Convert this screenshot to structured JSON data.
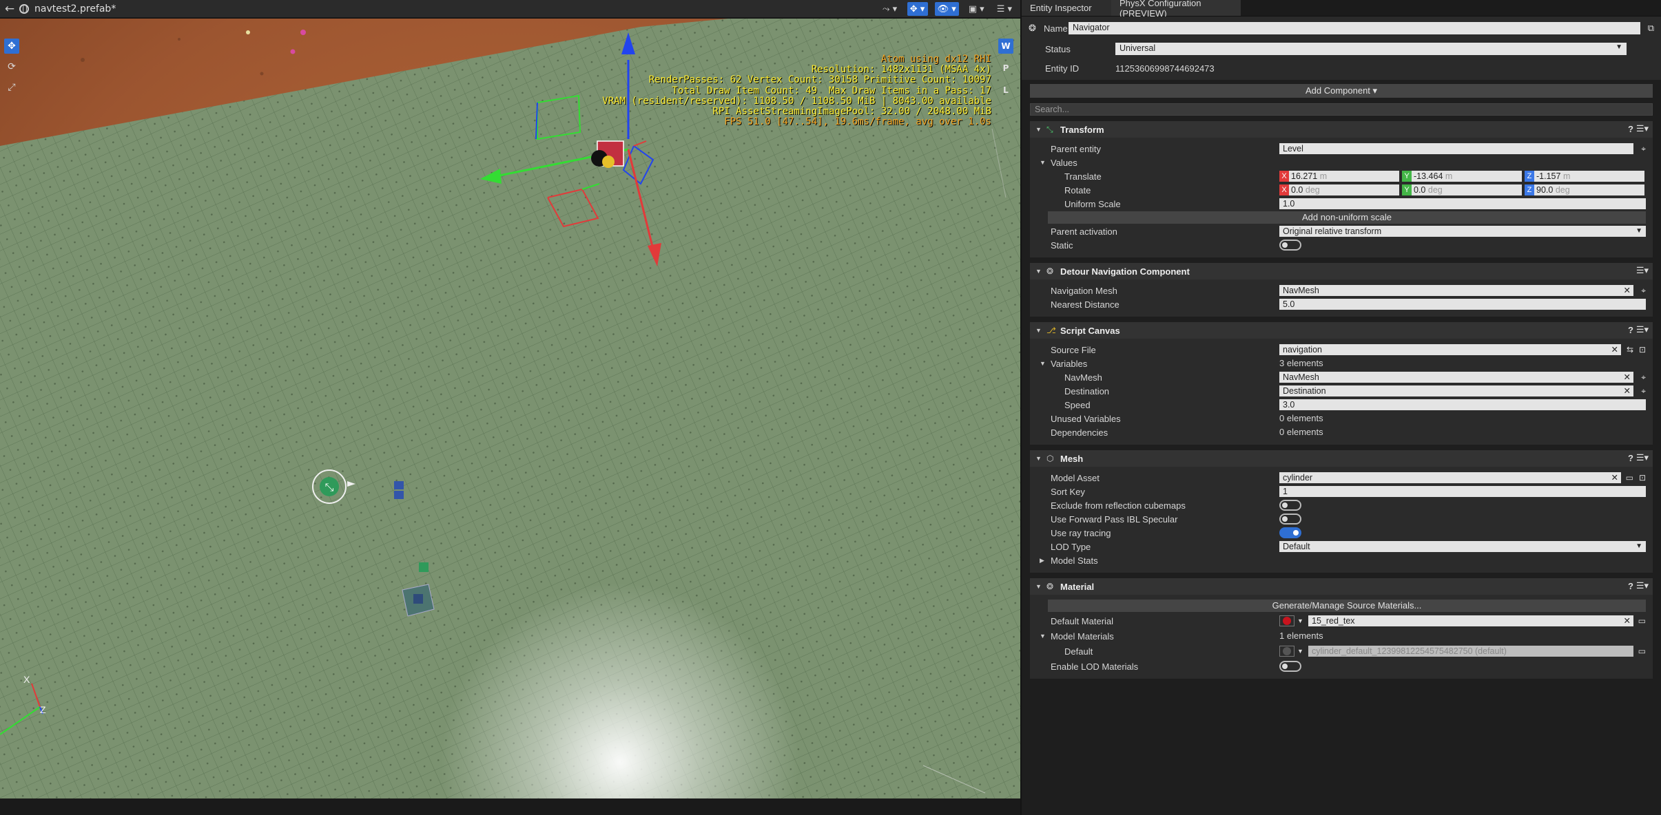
{
  "viewport": {
    "back_icon": "back-arrow-icon",
    "title": "navtest2.prefab*",
    "toolbar_tools": [
      {
        "name": "camera-speed-tool",
        "glyph": "⤳ ▾",
        "active": false
      },
      {
        "name": "gizmo-mode-tool",
        "glyph": "✥ ▾",
        "active": true
      },
      {
        "name": "visibility-tool",
        "glyph": "👁 ▾",
        "active": true
      },
      {
        "name": "layout-tool",
        "glyph": "▣ ▾",
        "active": false
      },
      {
        "name": "options-tool",
        "glyph": "☰ ▾",
        "active": false
      }
    ],
    "left_tools": [
      {
        "name": "move-tool",
        "glyph": "✥",
        "active": true
      },
      {
        "name": "rotate-tool",
        "glyph": "⟳",
        "active": false
      },
      {
        "name": "scale-tool",
        "glyph": "⤢",
        "active": false
      }
    ],
    "right_tools": [
      {
        "name": "world-space-toggle",
        "glyph": "W",
        "active": true
      },
      {
        "name": "parent-space-toggle",
        "glyph": "P",
        "active": false
      },
      {
        "name": "local-space-toggle",
        "glyph": "L",
        "active": false
      }
    ],
    "debug_lines": [
      "Atom using dx12 RHI",
      "Resolution: 1482x1131 (MSAA 4x)",
      "RenderPasses: 62 Vertex Count: 30158 Primitive Count: 10097",
      "Total Draw Item Count: 49  Max Draw Items in a Pass: 17",
      "VRAM (resident/reserved): 1108.50 / 1108.50 MiB | 8043.00 available",
      "RPI AssetStreamingImagePool: 32.00 / 2048.00 MiB",
      "FPS 51.0 [47..54], 19.6ms/frame, avg over 1.0s"
    ],
    "axis_labels": {
      "x": "X",
      "z": "Z"
    },
    "colors": {
      "accent": "#2f6fd3",
      "gizmo_x": "#e23a3a",
      "gizmo_y": "#33dd33",
      "gizmo_z": "#2244ee",
      "debug_text": "#ffee33"
    }
  },
  "inspector": {
    "tabs": [
      {
        "label": "Entity Inspector",
        "active": true
      },
      {
        "label": "PhysX Configuration (PREVIEW)",
        "active": false
      }
    ],
    "name_label": "Name",
    "name_value": "Navigator",
    "status_label": "Status",
    "status_value": "Universal",
    "entity_id_label": "Entity ID",
    "entity_id_value": "11253606998744692473",
    "add_component": "Add Component ▾",
    "search_placeholder": "Search...",
    "transform": {
      "title": "Transform",
      "parent_entity_label": "Parent entity",
      "parent_entity_value": "Level",
      "values_label": "Values",
      "translate_label": "Translate",
      "translate": {
        "x": "16.271",
        "y": "-13.464",
        "z": "-1.157",
        "unit": "m"
      },
      "rotate_label": "Rotate",
      "rotate": {
        "x": "0.0",
        "y": "0.0",
        "z": "90.0",
        "unit": "deg"
      },
      "uniform_scale_label": "Uniform Scale",
      "uniform_scale_value": "1.0",
      "add_nonuniform": "Add non-uniform scale",
      "parent_activation_label": "Parent activation",
      "parent_activation_value": "Original relative transform",
      "static_label": "Static",
      "static_on": false
    },
    "detour": {
      "title": "Detour Navigation Component",
      "nav_mesh_label": "Navigation Mesh",
      "nav_mesh_value": "NavMesh",
      "nearest_label": "Nearest Distance",
      "nearest_value": "5.0"
    },
    "script_canvas": {
      "title": "Script Canvas",
      "source_file_label": "Source File",
      "source_file_value": "navigation",
      "variables_label": "Variables",
      "variables_value": "3 elements",
      "navmesh_label": "NavMesh",
      "navmesh_value": "NavMesh",
      "destination_label": "Destination",
      "destination_value": "Destination",
      "speed_label": "Speed",
      "speed_value": "3.0",
      "unused_label": "Unused Variables",
      "unused_value": "0 elements",
      "deps_label": "Dependencies",
      "deps_value": "0 elements"
    },
    "mesh": {
      "title": "Mesh",
      "model_asset_label": "Model Asset",
      "model_asset_value": "cylinder",
      "sort_key_label": "Sort Key",
      "sort_key_value": "1",
      "exclude_label": "Exclude from reflection cubemaps",
      "exclude_on": false,
      "forward_label": "Use Forward Pass IBL Specular",
      "forward_on": false,
      "raytrace_label": "Use ray tracing",
      "raytrace_on": true,
      "lod_type_label": "LOD Type",
      "lod_type_value": "Default",
      "model_stats_label": "Model Stats"
    },
    "material": {
      "title": "Material",
      "generate_button": "Generate/Manage Source Materials...",
      "default_material_label": "Default Material",
      "default_material_value": "15_red_tex",
      "default_material_color": "#c8141e",
      "model_materials_label": "Model Materials",
      "model_materials_value": "1 elements",
      "default_label": "Default",
      "default_value": "cylinder_default_12399812254575482750 (default)",
      "default_color": "#555555",
      "enable_lod_label": "Enable LOD Materials",
      "enable_lod_on": false
    }
  }
}
